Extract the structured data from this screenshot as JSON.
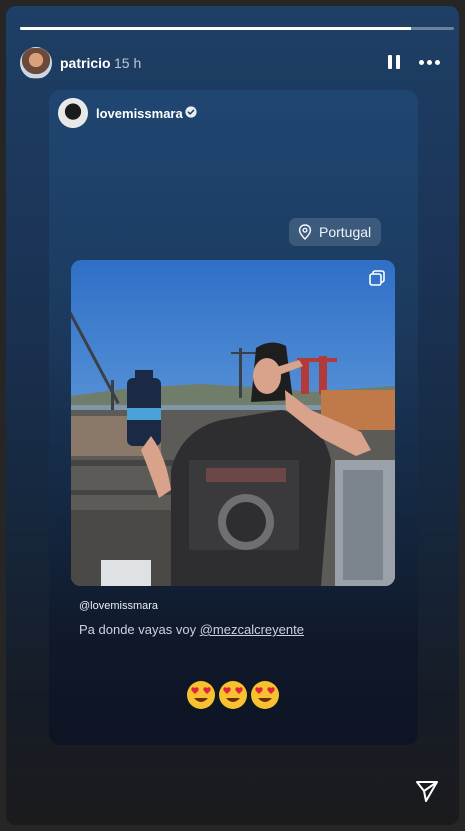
{
  "story": {
    "progress": 0.9,
    "author": "patricio",
    "time": "15 h"
  },
  "icons": {
    "pause": "pause-icon",
    "more": "more-icon",
    "verified": "verified-icon",
    "location": "map-pin-icon",
    "multi": "multiple-photos-icon",
    "share": "send-icon"
  },
  "post": {
    "username": "lovemissmara",
    "location": "Portugal",
    "mention": "@lovemissmara",
    "caption_text": "Pa donde vayas voy ",
    "caption_link": "@mezcalcreyente",
    "stickers": [
      "heart-eyes-emoji",
      "heart-eyes-emoji",
      "heart-eyes-emoji"
    ]
  }
}
